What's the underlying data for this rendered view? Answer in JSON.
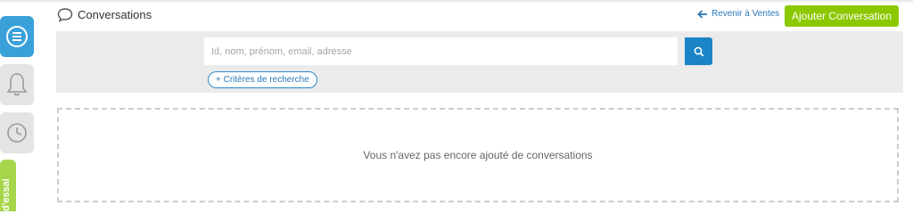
{
  "header": {
    "title": "Conversations",
    "back_link": "Revenir à Ventes",
    "add_button": "Ajouter Conversation"
  },
  "search": {
    "placeholder": "Id, nom, prénom, email, adresse",
    "value": "",
    "criteria_label": "+ Critères de recherche"
  },
  "sidebar": {
    "items": [
      {
        "icon": "menu-icon",
        "active": true
      },
      {
        "icon": "bell-icon",
        "active": false
      },
      {
        "icon": "history-icon",
        "active": false
      }
    ],
    "trial_label": "d'essai"
  },
  "main": {
    "empty_message": "Vous n'avez pas encore ajouté de conversations"
  },
  "colors": {
    "accent": "#1b84c6",
    "primary_button": "#8cc800",
    "rail_active": "#3aa0d8",
    "trial": "#a8d64a"
  }
}
